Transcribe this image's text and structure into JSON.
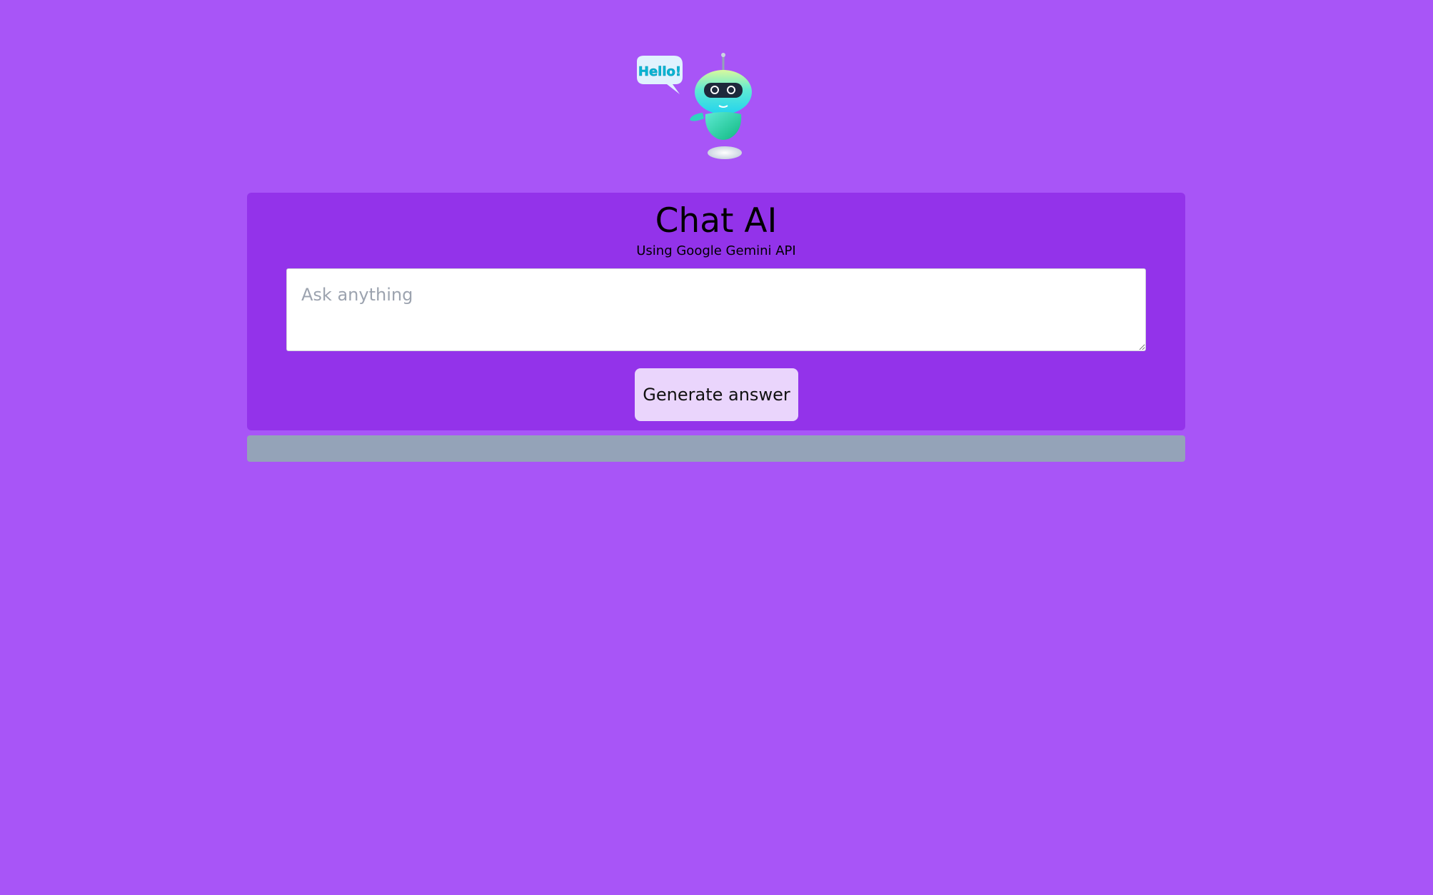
{
  "colors": {
    "background": "#a855f7",
    "card": "#9333ea",
    "button": "#ead5fc",
    "answer_bar": "#94a3b8",
    "robot_gradient_top": "#a7f3d0",
    "robot_gradient_bottom": "#22d3ee"
  },
  "logo": {
    "bubble_text": "Hello!",
    "icon": "robot-icon"
  },
  "header": {
    "title": "Chat AI",
    "subtitle": "Using Google Gemini API"
  },
  "prompt": {
    "placeholder": "Ask anything",
    "value": ""
  },
  "actions": {
    "generate_label": "Generate answer"
  },
  "answer": {
    "text": ""
  }
}
